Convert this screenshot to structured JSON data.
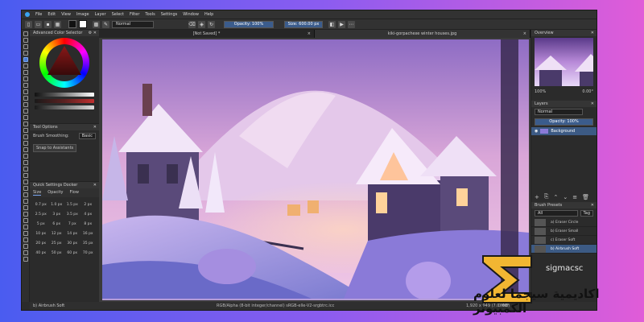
{
  "menu": [
    "File",
    "Edit",
    "View",
    "Image",
    "Layer",
    "Select",
    "Filter",
    "Tools",
    "Settings",
    "Window",
    "Help"
  ],
  "toolbar": {
    "blend_mode": "Normal",
    "opacity_label": "Opacity: 100%",
    "size_label": "Size: 600.00 px"
  },
  "document_tabs": [
    {
      "title": "[Not Saved] *",
      "close": "×"
    },
    {
      "title": "kiki-gorpachexe winter houses.jpg",
      "close": "×"
    }
  ],
  "left_dock": {
    "color_selector_title": "Advanced Color Selector",
    "tool_options_title": "Tool Options",
    "brush_smoothing_label": "Brush Smoothing:",
    "brush_smoothing_value": "Basic",
    "snap_label": "Snap to Assistants",
    "quick_settings_title": "Quick Settings Docker",
    "quick_tabs": [
      "Size",
      "Opacity",
      "Flow"
    ],
    "sizes": [
      "0.7 px",
      "1.0 px",
      "1.5 px",
      "2 px",
      "2.5 px",
      "3 px",
      "3.5 px",
      "4 px",
      "5 px",
      "6 px",
      "7 px",
      "8 px",
      "10 px",
      "12 px",
      "14 px",
      "16 px",
      "20 px",
      "25 px",
      "30 px",
      "35 px",
      "40 px",
      "50 px",
      "60 px",
      "70 px"
    ],
    "brush_status": "b) Airbrush Soft"
  },
  "right_dock": {
    "overview_title": "Overview",
    "zoom": "100%",
    "rotation": "0.00°",
    "layers_title": "Layers",
    "layer_blend": "Normal",
    "layer_opacity": "Opacity: 100%",
    "layer_name": "Background",
    "brush_presets_title": "Brush Presets",
    "preset_filter": "All",
    "preset_tag": "Tag",
    "presets": [
      "a) Eraser Circle",
      "b) Eraser Small",
      "c) Eraser Soft",
      "b) Airbrush Soft"
    ]
  },
  "status": {
    "color_info": "RGB/Alpha (8-bit integer/channel)  sRGB-elle-V2-srgbtrc.icc",
    "dimensions": "1,920 x 949 (7.0 MiB)",
    "zoom": "0.00°"
  },
  "watermark": {
    "text": "اكاديمية سيجما لعلوم الكمبيوتر",
    "sub": "sigmacsc"
  }
}
